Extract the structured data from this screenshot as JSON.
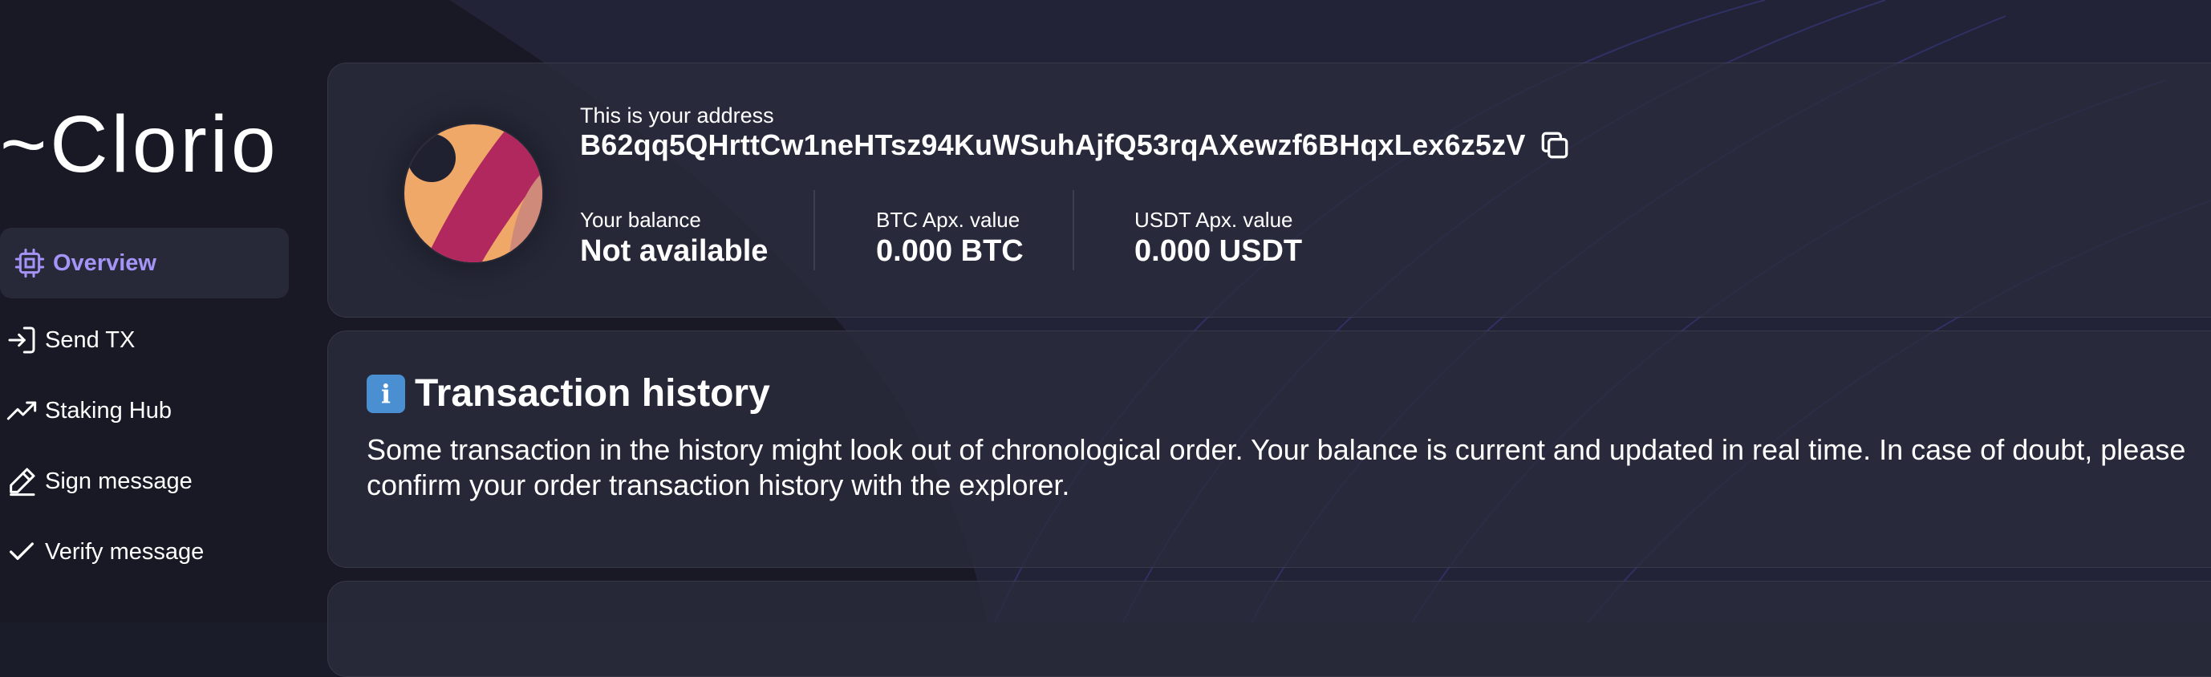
{
  "app": {
    "logo_text": "~Clorio"
  },
  "sidebar": {
    "items": [
      {
        "label": "Overview",
        "icon": "chip-icon",
        "active": true
      },
      {
        "label": "Send TX",
        "icon": "sign-in-icon",
        "active": false
      },
      {
        "label": "Staking Hub",
        "icon": "trending-up-icon",
        "active": false
      },
      {
        "label": "Sign message",
        "icon": "pen-icon",
        "active": false
      },
      {
        "label": "Verify message",
        "icon": "check-icon",
        "active": false
      }
    ]
  },
  "wallet": {
    "address_label": "This is your address",
    "address": "B62qq5QHrttCw1neHTsz94KuWSuhAjfQ53rqAXewzf6BHqxLex6z5zV",
    "copy_icon": "copy-icon",
    "balance_label": "Your balance",
    "balance_value": "Not available",
    "btc_label": "BTC Apx. value",
    "btc_value": "0.000 BTC",
    "usdt_label": "USDT Apx. value",
    "usdt_value": "0.000 USDT"
  },
  "transactions": {
    "icon": "info-icon",
    "title": "Transaction history",
    "notice": "Some transaction in the history might look out of chronological order. Your balance is current and updated in real time. In case of doubt, please confirm your order transaction history with the explorer."
  },
  "colors": {
    "background": "#1b1c2a",
    "accent": "#a494f7",
    "card": "#2a2c3c",
    "avatar_orange": "#f0a868",
    "avatar_crimson": "#b0285e",
    "avatar_rose": "#d08a7a"
  }
}
